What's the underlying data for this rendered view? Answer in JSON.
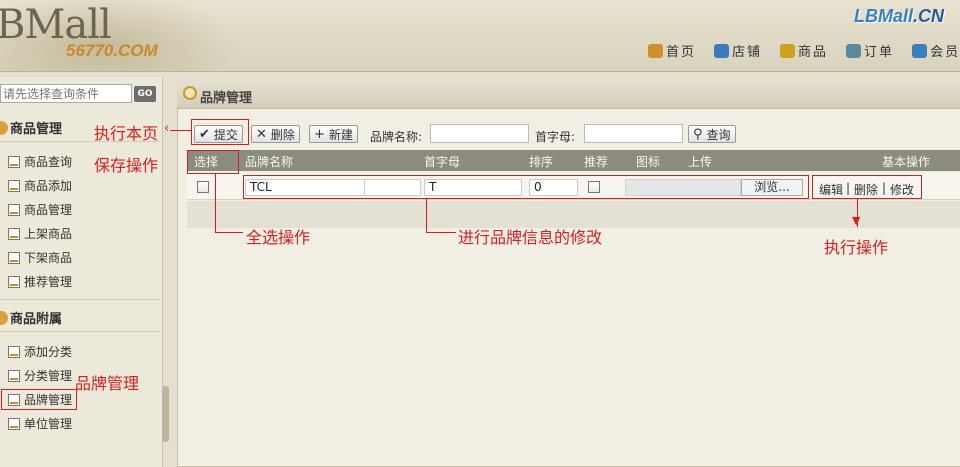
{
  "header": {
    "logo_text": "BMall",
    "logo_sub": "56770.COM",
    "brand_logo_main": "LBMall",
    "brand_logo_suffix": ".CN",
    "nav": [
      {
        "label": "首页",
        "icon": "home-icon",
        "color": "#d0902a"
      },
      {
        "label": "店铺",
        "icon": "store-icon",
        "color": "#3a7ac0"
      },
      {
        "label": "商品",
        "icon": "goods-icon",
        "color": "#d0a020"
      },
      {
        "label": "订单",
        "icon": "order-icon",
        "color": "#5a8a9a"
      },
      {
        "label": "会员",
        "icon": "member-icon",
        "color": "#3a80c0"
      }
    ]
  },
  "sidebar": {
    "search_placeholder": "请先选择查询条件",
    "go_label": "GO",
    "groups": [
      {
        "title": "商品管理",
        "items": [
          "商品查询",
          "商品添加",
          "商品管理",
          "上架商品",
          "下架商品",
          "推荐管理"
        ]
      },
      {
        "title": "商品附属",
        "items": [
          "添加分类",
          "分类管理",
          "品牌管理",
          "单位管理"
        ]
      }
    ]
  },
  "panel": {
    "title": "品牌管理",
    "toolbar": {
      "submit_label": "提交",
      "delete_label": "删除",
      "new_label": "新建",
      "brand_name_label": "品牌名称:",
      "initial_label": "首字母:",
      "query_label": "查询"
    },
    "table": {
      "columns": [
        "选择",
        "品牌名称",
        "首字母",
        "排序",
        "推荐",
        "图标",
        "上传",
        "基本操作"
      ],
      "rows": [
        {
          "brand_name": "TCL",
          "initial": "T",
          "sort": "0",
          "browse_label": "浏览...",
          "actions": [
            "编辑",
            "删除",
            "修改"
          ]
        }
      ]
    }
  },
  "annotations": {
    "execute_page": "执行本页",
    "save_operation": "保存操作",
    "select_all": "全选操作",
    "edit_brand_info": "进行品牌信息的修改",
    "execute_operation": "执行操作",
    "brand_management": "品牌管理"
  },
  "colors": {
    "annotation_red": "#d02020",
    "table_header": "#8c8c7e",
    "brand_blue": "#3b7fc4",
    "logo_orange": "#c88a2a"
  }
}
